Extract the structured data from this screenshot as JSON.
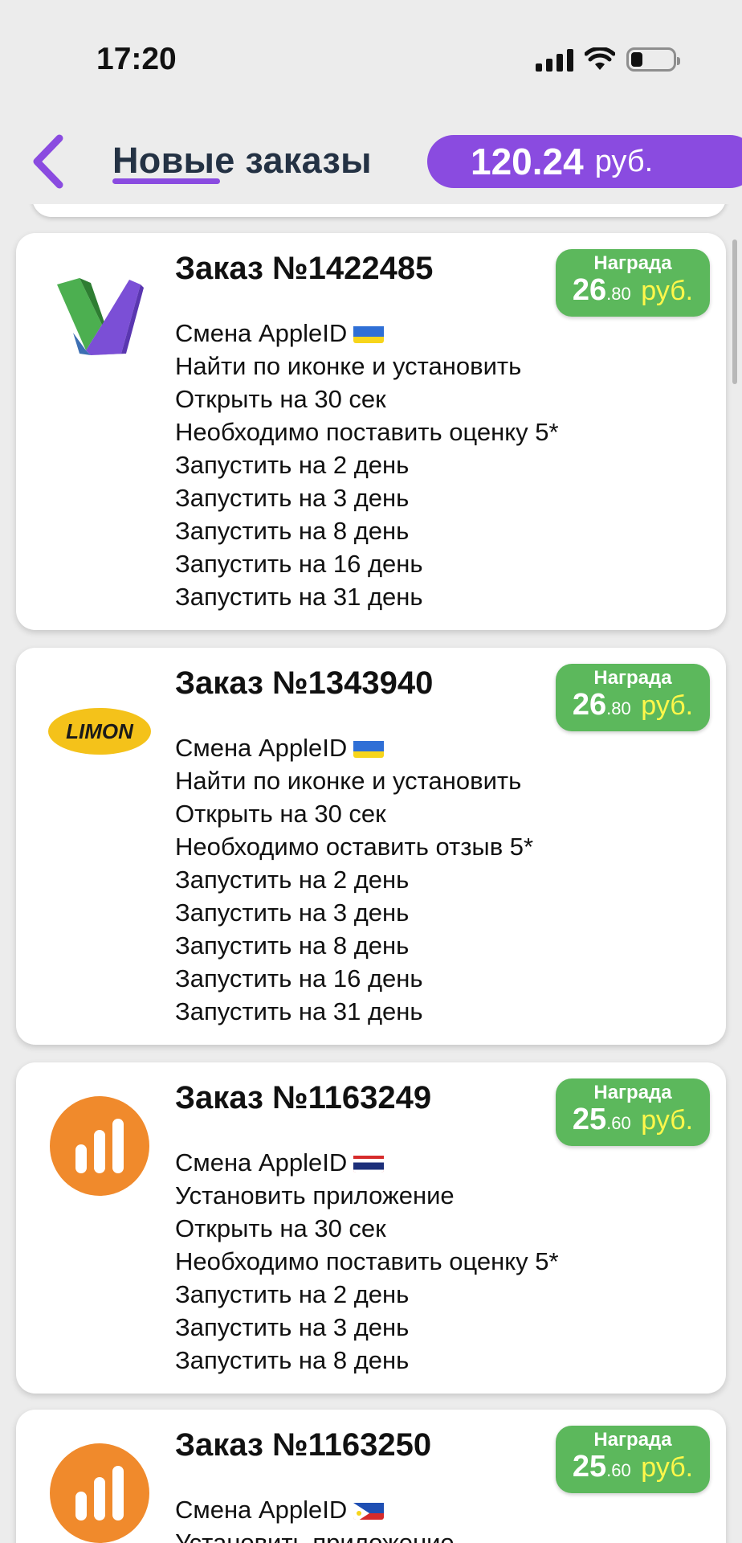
{
  "status_bar": {
    "time": "17:20",
    "icons": [
      "cellular-signal-icon",
      "wifi-icon",
      "battery-icon"
    ]
  },
  "header": {
    "back_icon": "chevron-left-icon",
    "title": "Новые заказы",
    "balance_value": "120.24",
    "balance_currency": "руб."
  },
  "colors": {
    "accent": "#8a4be0",
    "reward_bg": "#5cb85c",
    "reward_currency": "#fff74a",
    "title_color": "#243244"
  },
  "orders": [
    {
      "title": "Заказ №1422485",
      "logo": "vertical-app-logo",
      "reward_label": "Награда",
      "reward_whole": "26",
      "reward_cents": ".80",
      "reward_currency": "руб.",
      "flag": "ukraine-flag",
      "lines": [
        "Смена AppleID",
        "Найти по иконке и установить",
        "Открыть на 30 сек",
        "Необходимо поставить оценку 5*",
        "Запустить на 2 день",
        "Запустить на 3 день",
        "Запустить на 8 день",
        "Запустить на 16 день",
        "Запустить на 31 день"
      ]
    },
    {
      "title": "Заказ №1343940",
      "logo": "limon-logo",
      "logo_text": "LIMON",
      "reward_label": "Награда",
      "reward_whole": "26",
      "reward_cents": ".80",
      "reward_currency": "руб.",
      "flag": "ukraine-flag",
      "lines": [
        "Смена AppleID",
        "Найти по иконке и установить",
        "Открыть на 30 сек",
        "Необходимо оставить отзыв 5*",
        "Запустить на 2 день",
        "Запустить на 3 день",
        "Запустить на 8 день",
        "Запустить на 16 день",
        "Запустить на 31 день"
      ]
    },
    {
      "title": "Заказ №1163249",
      "logo": "orange-bars-logo",
      "reward_label": "Награда",
      "reward_whole": "25",
      "reward_cents": ".60",
      "reward_currency": "руб.",
      "flag": "thailand-flag",
      "lines": [
        "Смена AppleID",
        "Установить приложение",
        "Открыть на 30 сек",
        "Необходимо поставить оценку 5*",
        "Запустить на 2 день",
        "Запустить на 3 день",
        "Запустить на 8 день"
      ]
    },
    {
      "title": "Заказ №1163250",
      "logo": "orange-bars-logo",
      "reward_label": "Награда",
      "reward_whole": "25",
      "reward_cents": ".60",
      "reward_currency": "руб.",
      "flag": "philippines-flag",
      "lines": [
        "Смена AppleID",
        "Установить приложение"
      ]
    }
  ]
}
